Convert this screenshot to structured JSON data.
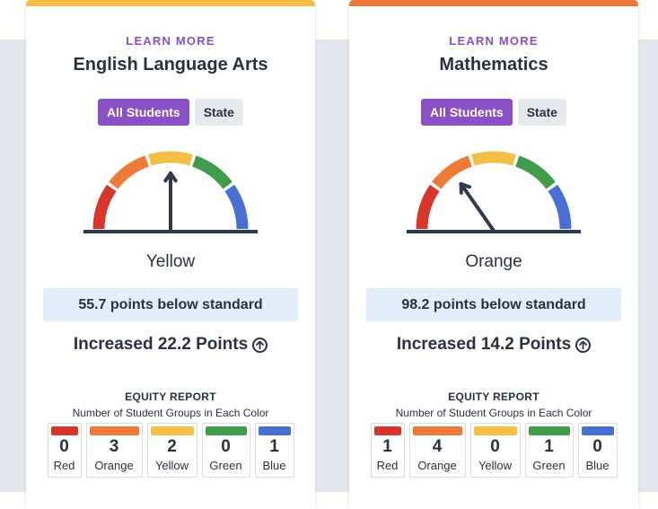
{
  "colors": {
    "red": "#d9362b",
    "orange": "#ee7a3a",
    "yellow": "#f4bf45",
    "green": "#3f9c4b",
    "blue": "#4a6fd4",
    "accent": "#8a4fc5"
  },
  "cards": [
    {
      "learn_more": "LEARN MORE",
      "subject": "English Language Arts",
      "toggle_all": "All Students",
      "toggle_state": "State",
      "gauge_value": "Yellow",
      "status_label": "Yellow",
      "distance": "55.7 points below standard",
      "change": "Increased 22.2 Points",
      "change_icon": "arrow-up-circle-icon",
      "equity_title": "EQUITY REPORT",
      "equity_subtitle": "Number of Student Groups in Each Color",
      "equity": [
        {
          "label": "Red",
          "count": "0"
        },
        {
          "label": "Orange",
          "count": "3"
        },
        {
          "label": "Yellow",
          "count": "2"
        },
        {
          "label": "Green",
          "count": "0"
        },
        {
          "label": "Blue",
          "count": "1"
        }
      ]
    },
    {
      "learn_more": "LEARN MORE",
      "subject": "Mathematics",
      "toggle_all": "All Students",
      "toggle_state": "State",
      "gauge_value": "Orange",
      "status_label": "Orange",
      "distance": "98.2 points below standard",
      "change": "Increased 14.2 Points",
      "change_icon": "arrow-up-circle-icon",
      "equity_title": "EQUITY REPORT",
      "equity_subtitle": "Number of Student Groups in Each Color",
      "equity": [
        {
          "label": "Red",
          "count": "1"
        },
        {
          "label": "Orange",
          "count": "4"
        },
        {
          "label": "Yellow",
          "count": "0"
        },
        {
          "label": "Green",
          "count": "1"
        },
        {
          "label": "Blue",
          "count": "0"
        }
      ]
    }
  ]
}
